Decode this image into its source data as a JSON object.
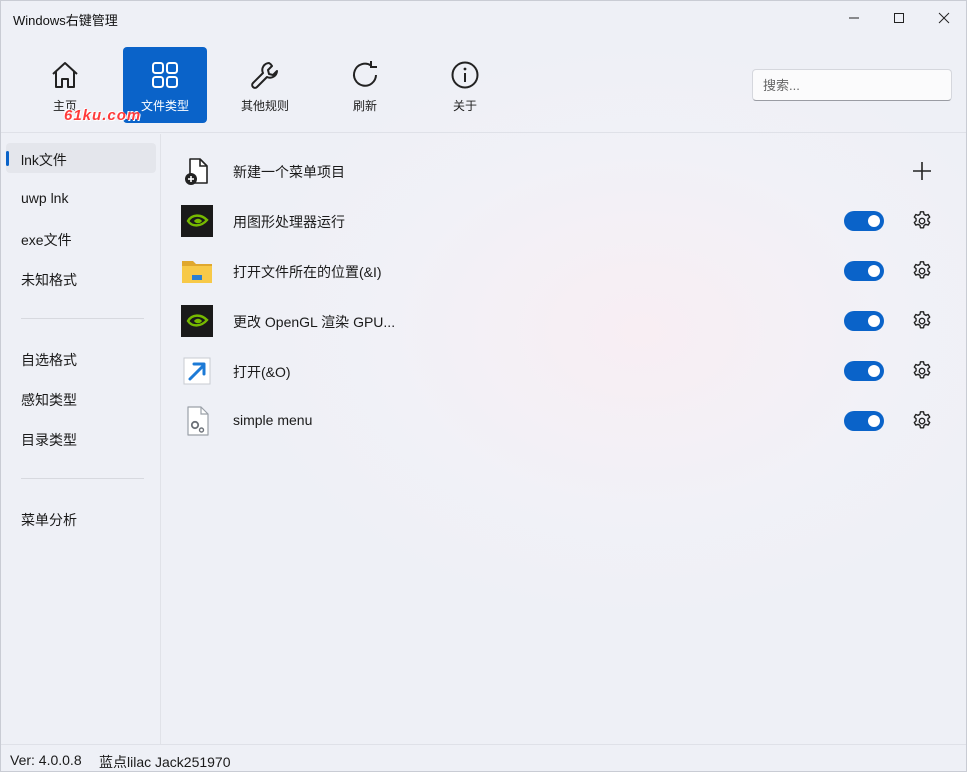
{
  "window": {
    "title": "Windows右键管理"
  },
  "toolbar": {
    "items": [
      {
        "label": "主页",
        "icon": "home-icon"
      },
      {
        "label": "文件类型",
        "icon": "grid-icon",
        "active": true
      },
      {
        "label": "其他规则",
        "icon": "wrench-icon"
      },
      {
        "label": "刷新",
        "icon": "refresh-icon"
      },
      {
        "label": "关于",
        "icon": "info-icon"
      }
    ],
    "watermark": "61ku.com",
    "search_placeholder": "搜索..."
  },
  "sidebar": {
    "items": [
      {
        "label": "lnk文件",
        "active": true
      },
      {
        "label": "uwp lnk"
      },
      {
        "label": "exe文件"
      },
      {
        "label": "未知格式"
      },
      {
        "label": "自选格式"
      },
      {
        "label": "感知类型"
      },
      {
        "label": "目录类型"
      },
      {
        "label": "菜单分析"
      }
    ]
  },
  "content": {
    "new_item_label": "新建一个菜单项目",
    "rows": [
      {
        "label": "用图形处理器运行",
        "icon": "nvidia-icon",
        "enabled": true
      },
      {
        "label": "打开文件所在的位置(&I)",
        "icon": "folder-icon",
        "enabled": true
      },
      {
        "label": "更改 OpenGL 渲染 GPU...",
        "icon": "nvidia-icon",
        "enabled": true
      },
      {
        "label": "打开(&O)",
        "icon": "shortcut-arrow-icon",
        "enabled": true
      },
      {
        "label": "simple menu",
        "icon": "settings-file-icon",
        "enabled": true
      }
    ]
  },
  "status": {
    "version": "Ver: 4.0.0.8",
    "author": "蓝点lilac Jack251970"
  },
  "colors": {
    "accent": "#0a63c9",
    "nvidia_green": "#76b900",
    "folder_yellow": "#f5c13b"
  }
}
